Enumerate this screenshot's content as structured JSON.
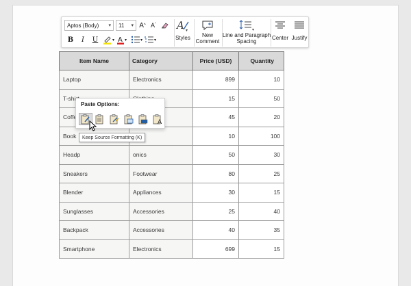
{
  "toolbar": {
    "font_name": "Aptos (Body)",
    "font_size": "11",
    "bold": "B",
    "italic": "I",
    "underline": "U",
    "styles_label": "Styles",
    "new_comment_label": "New Comment",
    "line_spacing_label": "Line and Paragraph Spacing",
    "center_label": "Center",
    "justify_label": "Justify",
    "highlight_color": "#f5e50a",
    "font_color": "#e02020"
  },
  "table": {
    "headers": [
      "Item Name",
      "Category",
      "Price (USD)",
      "Quantity"
    ],
    "rows": [
      [
        "Laptop",
        "Electronics",
        "899",
        "10"
      ],
      [
        "T-shirt",
        "Clothing",
        "15",
        "50"
      ],
      [
        "Coffee",
        "",
        "45",
        "20"
      ],
      [
        "Book",
        "",
        "10",
        "100"
      ],
      [
        "Headp",
        "onics",
        "50",
        "30"
      ],
      [
        "Sneakers",
        "Footwear",
        "80",
        "25"
      ],
      [
        "Blender",
        "Appliances",
        "30",
        "15"
      ],
      [
        "Sunglasses",
        "Accessories",
        "25",
        "40"
      ],
      [
        "Backpack",
        "Accessories",
        "40",
        "35"
      ],
      [
        "Smartphone",
        "Electronics",
        "699",
        "15"
      ]
    ]
  },
  "paste_options": {
    "title": "Paste Options:",
    "tooltip": "Keep Source Formatting (K)",
    "icons": [
      "keep-source-formatting-icon",
      "use-destination-styles-icon",
      "merge-formatting-icon",
      "paste-picture-icon",
      "paste-link-icon",
      "keep-text-only-icon"
    ]
  }
}
